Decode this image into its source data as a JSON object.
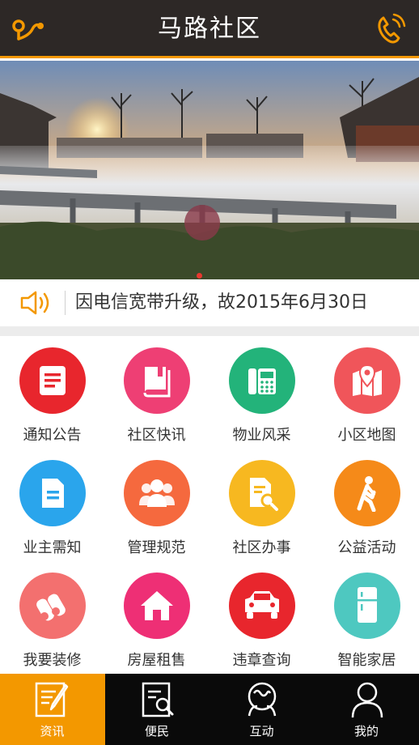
{
  "header": {
    "title": "马路社区",
    "left_icon": "location-route-icon",
    "right_icon": "phone-icon",
    "accent": "#f39800"
  },
  "banner": {
    "description_icon": "banner-photo"
  },
  "notice": {
    "icon": "speaker-icon",
    "text": "因电信宽带升级，故2015年6月30日"
  },
  "menu": [
    {
      "label": "通知公告",
      "icon": "document-icon",
      "color": "#e8262d"
    },
    {
      "label": "社区快讯",
      "icon": "book-icon",
      "color": "#ee3f74"
    },
    {
      "label": "物业风采",
      "icon": "telephone-fax-icon",
      "color": "#23b37a"
    },
    {
      "label": "小区地图",
      "icon": "map-pin-icon",
      "color": "#f0555a"
    },
    {
      "label": "业主需知",
      "icon": "file-icon",
      "color": "#2aa5ec"
    },
    {
      "label": "管理规范",
      "icon": "group-icon",
      "color": "#f5693e"
    },
    {
      "label": "社区办事",
      "icon": "search-document-icon",
      "color": "#f7b820"
    },
    {
      "label": "公益活动",
      "icon": "walking-person-icon",
      "color": "#f58a19"
    },
    {
      "label": "我要装修",
      "icon": "pipes-icon",
      "color": "#f3706f"
    },
    {
      "label": "房屋租售",
      "icon": "house-icon",
      "color": "#ee2f75"
    },
    {
      "label": "违章查询",
      "icon": "car-icon",
      "color": "#e8262d"
    },
    {
      "label": "智能家居",
      "icon": "fridge-icon",
      "color": "#4ec8c0"
    }
  ],
  "tabs": [
    {
      "label": "资讯",
      "icon": "edit-icon",
      "active": true
    },
    {
      "label": "便民",
      "icon": "search-doc-icon",
      "active": false
    },
    {
      "label": "互动",
      "icon": "interact-icon",
      "active": false
    },
    {
      "label": "我的",
      "icon": "user-icon",
      "active": false
    }
  ]
}
